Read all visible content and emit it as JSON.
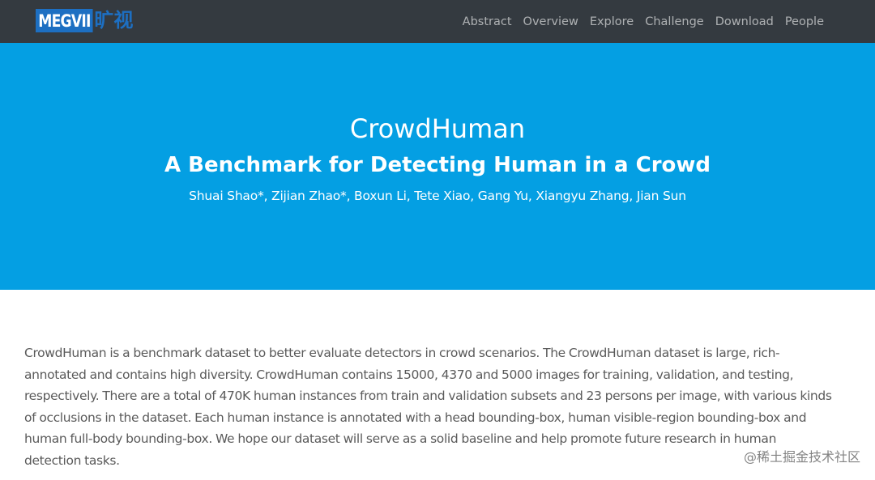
{
  "navbar": {
    "logo_text": "MEGVII",
    "logo_cn": "旷视",
    "links": [
      "Abstract",
      "Overview",
      "Explore",
      "Challenge",
      "Download",
      "People"
    ]
  },
  "hero": {
    "title": "CrowdHuman",
    "subtitle": "A Benchmark for Detecting Human in a Crowd",
    "authors": "Shuai Shao*, Zijian Zhao*, Boxun Li, Tete Xiao, Gang Yu, Xiangyu Zhang, Jian Sun"
  },
  "abstract": {
    "text": "CrowdHuman is a benchmark dataset to better evaluate detectors in crowd scenarios. The CrowdHuman dataset is large, rich-annotated and contains high diversity. CrowdHuman contains 15000, 4370 and 5000 images for training, validation, and testing, respectively. There are a total of 470K human instances from train and validation subsets and 23 persons per image, with various kinds of occlusions in the dataset. Each human instance is annotated with a head bounding-box, human visible-region bounding-box and human full-body bounding-box. We hope our dataset will serve as a solid baseline and help promote future research in human detection tasks."
  },
  "watermark": "@稀土掘金技术社区",
  "colors": {
    "navbar_bg": "#343a40",
    "hero_bg": "#049fe3",
    "logo_blue": "#1d6fc2",
    "body_text": "#5a5a5a"
  }
}
